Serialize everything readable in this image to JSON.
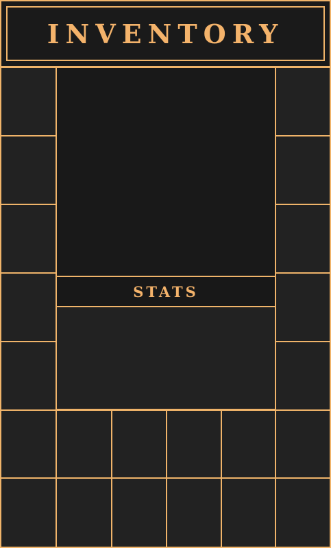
{
  "header": {
    "title": "INVENTORY"
  },
  "stats": {
    "label": "STATS"
  },
  "colors": {
    "accent": "#f0b46a",
    "slot": "#222222",
    "background": "#141414"
  },
  "inventory": {
    "left_column_slots": 7,
    "right_column_slots": 7,
    "bottom_rows": 2,
    "bottom_row_inner_slots": 4
  }
}
